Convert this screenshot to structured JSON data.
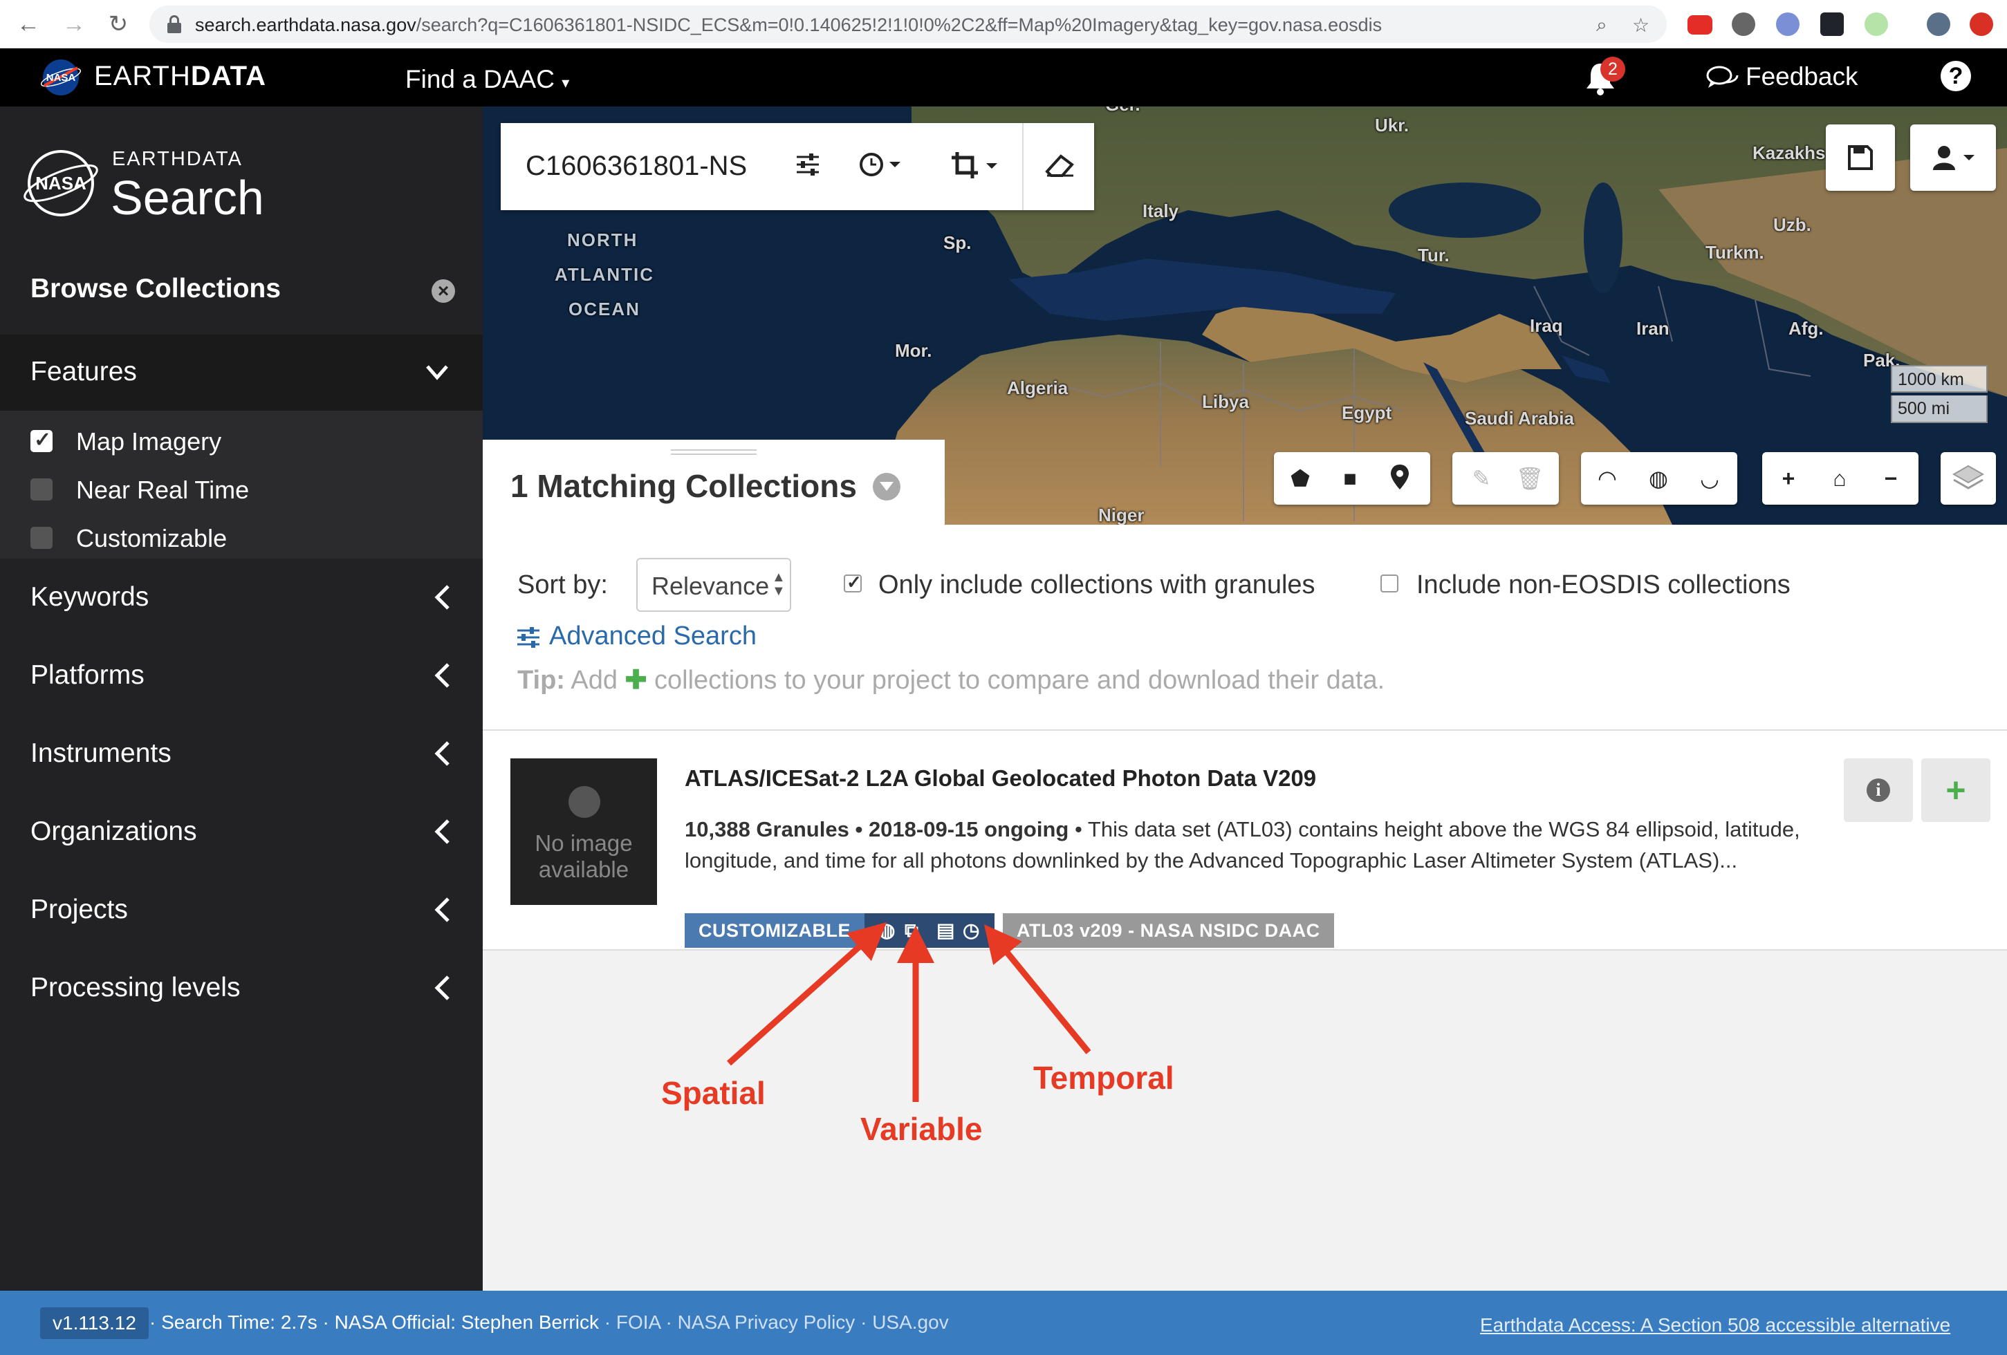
{
  "browser": {
    "url_host": "search.earthdata.nasa.gov",
    "url_path": "/search?q=C1606361801-NSIDC_ECS&m=0!0.140625!2!1!0!0%2C2&ff=Map%20Imagery&tag_key=gov.nasa.eosdis",
    "icons": [
      "back-icon",
      "forward-icon",
      "reload-icon",
      "lock-icon",
      "zoom-icon",
      "star-icon"
    ]
  },
  "header": {
    "brand_light": "EARTH",
    "brand_bold": "DATA",
    "find_daac": "Find a DAAC",
    "notification_count": "2",
    "feedback": "Feedback",
    "help": "?"
  },
  "sidebar": {
    "logo_top": "EARTHDATA",
    "logo_bottom": "Search",
    "browse_title": "Browse Collections",
    "features_title": "Features",
    "features": [
      {
        "label": "Map Imagery",
        "checked": true
      },
      {
        "label": "Near Real Time",
        "checked": false
      },
      {
        "label": "Customizable",
        "checked": false
      }
    ],
    "facets": [
      "Keywords",
      "Platforms",
      "Instruments",
      "Organizations",
      "Projects",
      "Processing levels"
    ]
  },
  "map": {
    "search_value": "C1606361801-NS",
    "labels": {
      "ukr": "Ukr.",
      "kazakh": "Kazakhs",
      "italy": "Italy",
      "sp": "Sp.",
      "tur": "Tur.",
      "uzb": "Uzb.",
      "turkm": "Turkm.",
      "north": "NORTH",
      "atlantic": "ATLANTIC",
      "ocean": "OCEAN",
      "iraq": "Iraq",
      "iran": "Iran",
      "afg": "Afg.",
      "mor": "Mor.",
      "pak": "Pak.",
      "algeria": "Algeria",
      "libya": "Libya",
      "egypt": "Egypt",
      "saudi": "Saudi Arabia",
      "niger": "Niger",
      "ger": "Ger."
    },
    "scale_km": "1000 km",
    "scale_mi": "500 mi"
  },
  "results": {
    "title": "1 Matching Collections",
    "sort_label": "Sort by:",
    "sort_value": "Relevance",
    "only_granules_label": "Only include collections with granules",
    "only_granules_checked": true,
    "non_eosdis_label": "Include non-EOSDIS collections",
    "non_eosdis_checked": false,
    "advanced_search": "Advanced Search",
    "tip_prefix": "Tip:",
    "tip_add": "Add",
    "tip_rest": "collections to your project to compare and download their data."
  },
  "collection": {
    "no_image_line1": "No image",
    "no_image_line2": "available",
    "title": "ATLAS/ICESat-2 L2A Global Geolocated Photon Data V209",
    "granules": "10,388 Granules",
    "dates": "2018-09-15 ongoing",
    "description_line1": "This data set (ATL03) contains height above the WGS 84 ellipsoid, latitude,",
    "description_line2": "longitude, and time for all photons downlinked by the Advanced Topographic Laser Altimeter System (ATLAS)...",
    "badge_customizable": "CUSTOMIZABLE",
    "badge_daac": "ATL03 v209 - NASA NSIDC DAAC"
  },
  "annotations": {
    "spatial": "Spatial",
    "variable": "Variable",
    "temporal": "Temporal",
    "color": "#e63a24"
  },
  "footer": {
    "version": "v1.113.12",
    "search_time": "Search Time: 2.7s",
    "official": "NASA Official: Stephen Berrick",
    "foia": "FOIA",
    "privacy": "NASA Privacy Policy",
    "usa": "USA.gov",
    "access": "Earthdata Access: A Section 508 accessible alternative"
  },
  "colors": {
    "sidebar": "#222224",
    "header": "#000000",
    "footer": "#3a7cc0",
    "badge_custom": "#4a7ab0",
    "badge_icons": "#2c4a72",
    "link": "#2a6aa8",
    "add_green": "#4cae4c"
  }
}
